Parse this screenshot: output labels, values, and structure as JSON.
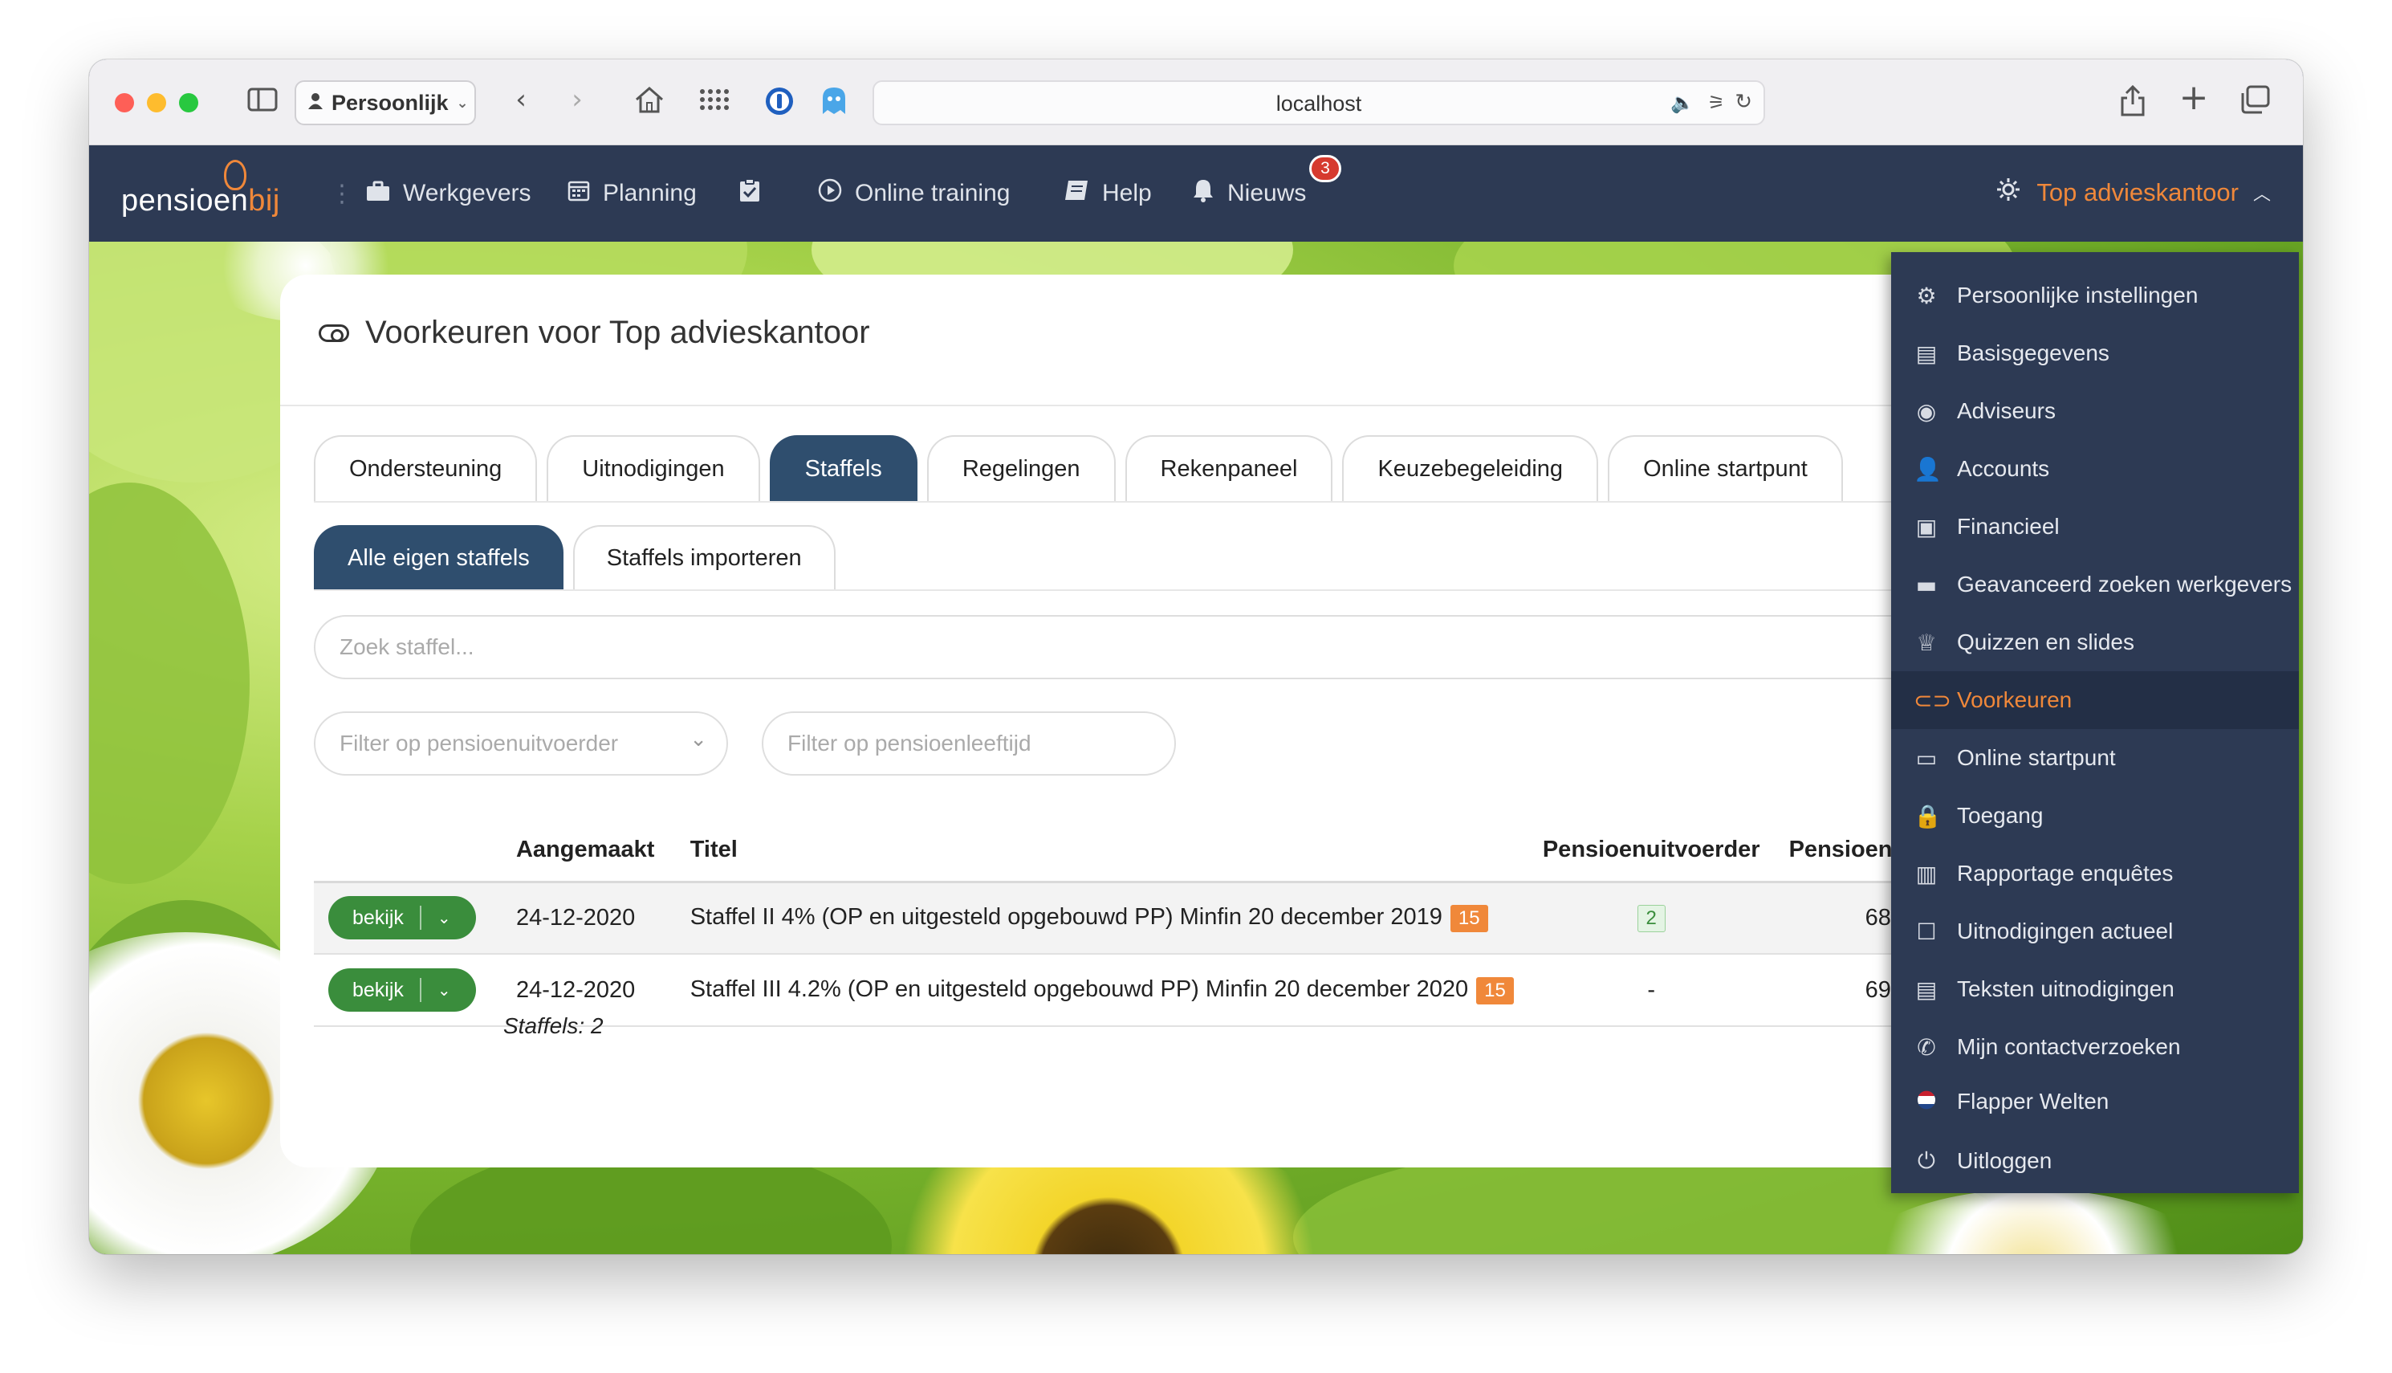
{
  "browser": {
    "profile_label": "Persoonlijk",
    "url": "localhost"
  },
  "appnav": {
    "logo_text": "pensioen",
    "logo_accent": "bij",
    "items": [
      {
        "label": "Werkgevers",
        "icon": "briefcase-icon"
      },
      {
        "label": "Planning",
        "icon": "calendar-icon"
      },
      {
        "label": "",
        "icon": "clipboard-check-icon"
      },
      {
        "label": "Online training",
        "icon": "play-circle-icon"
      },
      {
        "label": "Help",
        "icon": "book-icon"
      },
      {
        "label": "Nieuws",
        "icon": "bell-icon"
      }
    ],
    "news_count": "3",
    "account_label": "Top advieskantoor"
  },
  "panel": {
    "title": "Voorkeuren voor Top advieskantoor",
    "tabs": [
      {
        "label": "Ondersteuning",
        "active": false
      },
      {
        "label": "Uitnodigingen",
        "active": false
      },
      {
        "label": "Staffels",
        "active": true
      },
      {
        "label": "Regelingen",
        "active": false
      },
      {
        "label": "Rekenpaneel",
        "active": false
      },
      {
        "label": "Keuzebegeleiding",
        "active": false
      },
      {
        "label": "Online startpunt",
        "active": false
      }
    ],
    "subtabs": [
      {
        "label": "Alle eigen staffels",
        "active": true
      },
      {
        "label": "Staffels importeren",
        "active": false
      }
    ],
    "search_placeholder": "Zoek staffel...",
    "filter_uitvoerder_placeholder": "Filter op pensioenuitvoerder",
    "filter_leeftijd_placeholder": "Filter op pensioenleeftijd",
    "table": {
      "headers": [
        "",
        "Aangemaakt",
        "Titel",
        "Pensioenuitvoerder",
        "Pensioenleeftijd"
      ],
      "rows": [
        {
          "button": "bekijk",
          "aangemaakt": "24-12-2020",
          "titel": "Staffel II 4% (OP en uitgesteld opgebouwd PP) Minfin 20 december 2019",
          "titel_badge": "15",
          "uitvoerder": "2",
          "leeftijd": "68"
        },
        {
          "button": "bekijk",
          "aangemaakt": "24-12-2020",
          "titel": "Staffel III 4.2% (OP en uitgesteld opgebouwd PP) Minfin 20 december 2020",
          "titel_badge": "15",
          "uitvoerder": "-",
          "leeftijd": "69"
        }
      ],
      "footer": "Staffels: 2"
    }
  },
  "dropdown": {
    "items": [
      {
        "label": "Persoonlijke instellingen",
        "icon": "settings-wheel-icon"
      },
      {
        "label": "Basisgegevens",
        "icon": "document-icon"
      },
      {
        "label": "Adviseurs",
        "icon": "user-circle-icon"
      },
      {
        "label": "Accounts",
        "icon": "user-icon"
      },
      {
        "label": "Financieel",
        "icon": "wallet-icon"
      },
      {
        "label": "Geavanceerd zoeken werkgevers",
        "icon": "briefcase-icon"
      },
      {
        "label": "Quizzen en slides",
        "icon": "trophy-icon"
      },
      {
        "label": "Voorkeuren",
        "icon": "toggle-icon",
        "active": true
      },
      {
        "label": "Online startpunt",
        "icon": "monitor-icon"
      },
      {
        "label": "Toegang",
        "icon": "lock-icon"
      },
      {
        "label": "Rapportage enquêtes",
        "icon": "chart-board-icon"
      },
      {
        "label": "Uitnodigingen actueel",
        "icon": "inbox-icon"
      },
      {
        "label": "Teksten uitnodigingen",
        "icon": "text-document-icon"
      },
      {
        "label": "Mijn contactverzoeken",
        "icon": "phone-icon"
      },
      {
        "label": "Flapper Welten",
        "icon": "dutch-flag-icon"
      },
      {
        "label": "Uitloggen",
        "icon": "power-icon"
      }
    ]
  },
  "colors": {
    "nav_bg": "#2d3a54",
    "accent_orange": "#f0883a",
    "tab_active": "#2f4e6e",
    "button_green": "#3a8d3c",
    "badge_red": "#d63a2f"
  }
}
